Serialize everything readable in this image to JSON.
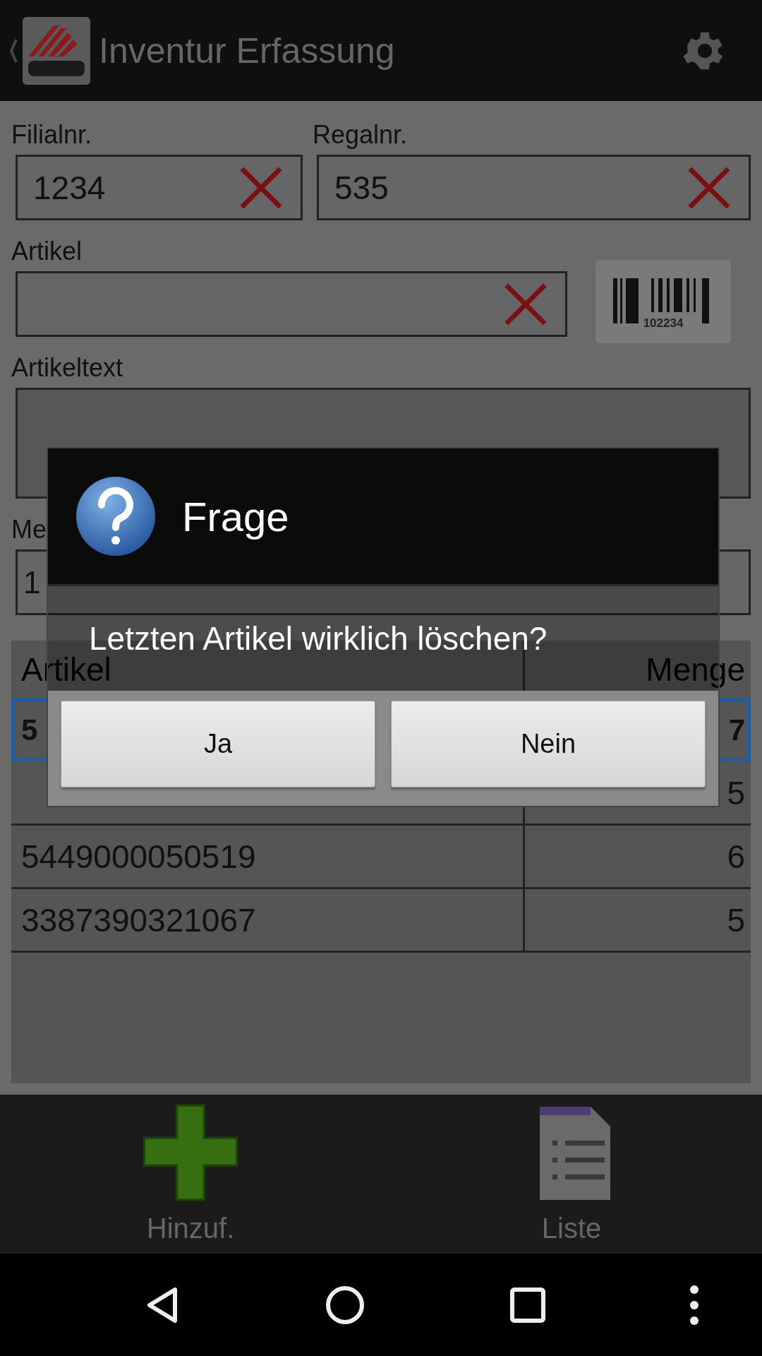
{
  "action_bar": {
    "title": "Inventur Erfassung"
  },
  "store_field": {
    "label": "Filialnr.",
    "value": "1234"
  },
  "shelf_field": {
    "label": "Regalnr.",
    "value": "535"
  },
  "article_field": {
    "label": "Artikel"
  },
  "barcode_button": {
    "number": "102234"
  },
  "article_text": {
    "label": "Artikeltext"
  },
  "quantity_field": {
    "label": "Me",
    "value": "1"
  },
  "table": {
    "columns": [
      "Artikel",
      "Menge"
    ],
    "rows": [
      {
        "article": "5",
        "quantity": "7",
        "selected": true
      },
      {
        "quantity": "5",
        "selected": false
      },
      {
        "article": "5449000050519",
        "quantity": "6",
        "selected": false
      },
      {
        "article": "3387390321067",
        "quantity": "5",
        "selected": false
      }
    ]
  },
  "dialog": {
    "title": "Frage",
    "message": "Letzten Artikel wirklich löschen?",
    "buttons": [
      "Ja",
      "Nein"
    ]
  },
  "toolbar": [
    {
      "label": "Hinzuf.",
      "kind": "add"
    },
    {
      "label": "Liste",
      "kind": "list"
    }
  ]
}
